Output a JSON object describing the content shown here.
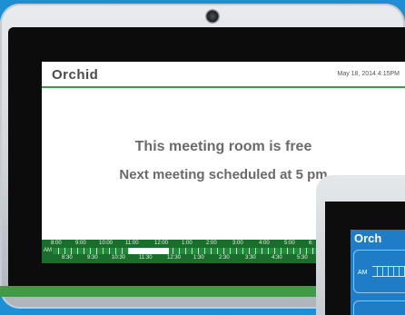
{
  "main_screen": {
    "brand": "Orchid",
    "datetime": "May 18, 2014 4:15PM",
    "status_line": "This meeting room is free",
    "next_line": "Next meeting scheduled at 5 pm",
    "timeline": {
      "top_ticks": [
        "8:00",
        "9:00",
        "10:00",
        "11:00",
        "12:00",
        "1:00",
        "2:00",
        "3:00",
        "4:00",
        "5:00",
        "6:"
      ],
      "bottom_ticks": [
        "8:30",
        "9:30",
        "10:30",
        "11:30",
        "12:30",
        "1:30",
        "2:30",
        "3:30",
        "4:30",
        "5:30"
      ],
      "period_label": "AM",
      "colors": {
        "background": "#1a6e2c",
        "free_slot": "#ffffff",
        "current": "#3cb6e6"
      }
    }
  },
  "secondary_screen": {
    "brand": "Orch",
    "period_label": "AM"
  },
  "colors": {
    "accent_green": "#2aa24a",
    "background_blue": "#1e8fd2",
    "text_gray": "#6a6a6a"
  }
}
